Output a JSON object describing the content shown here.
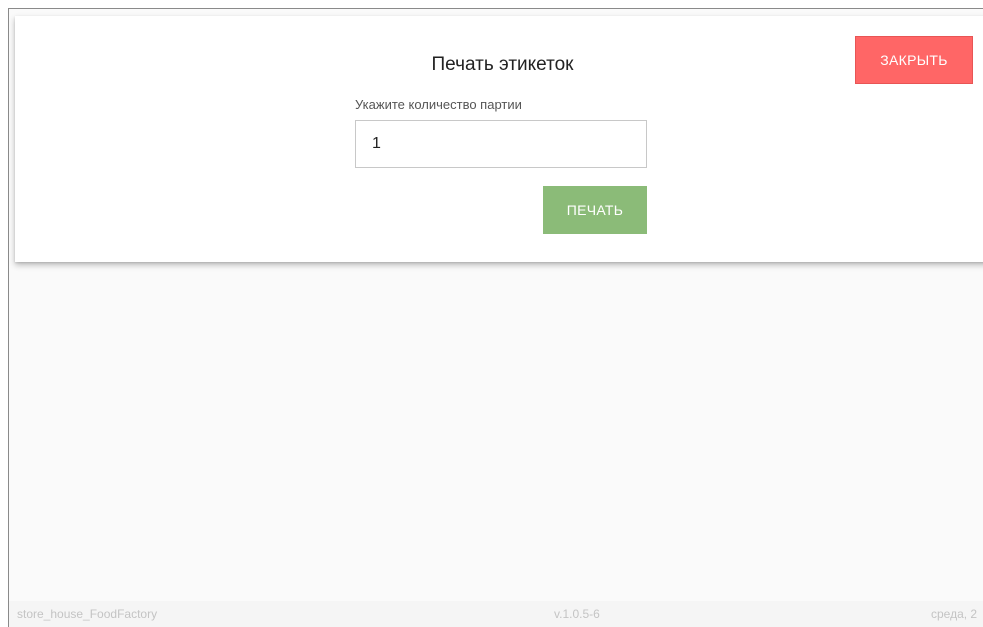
{
  "dialog": {
    "title": "Печать этикеток",
    "close_label": "ЗАКРЫТЬ",
    "quantity_label": "Укажите количество партии",
    "quantity_value": "1",
    "print_label": "ПЕЧАТЬ"
  },
  "footer": {
    "app_name": "store_house_FoodFactory",
    "version": "v.1.0.5-6",
    "date": "среда, 2"
  },
  "colors": {
    "close_button": "#ff6666",
    "print_button": "#8bbb78",
    "page_background": "#fafafa"
  }
}
